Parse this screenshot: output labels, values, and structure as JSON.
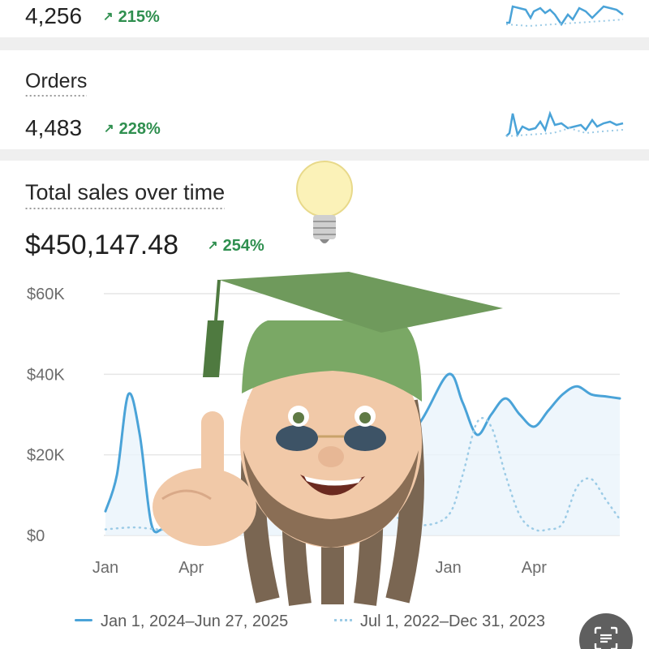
{
  "metrics": [
    {
      "title": "",
      "value": "4,256",
      "change": "215%"
    },
    {
      "title": "Orders",
      "value": "4,483",
      "change": "228%"
    }
  ],
  "sales": {
    "title": "Total sales over time",
    "total": "$450,147.48",
    "change": "254%"
  },
  "colors": {
    "accent": "#4aa3d8",
    "comparison": "#9ccbe6",
    "positive": "#2f8f4f",
    "gridline": "#e6e6e6"
  },
  "icons": {
    "change_arrow": "arrow-up-right-icon",
    "fab": "scan-text-icon",
    "overlay": "graduate-memoji-with-lightbulb"
  },
  "chart_data": {
    "type": "line",
    "title": "Total sales over time",
    "xlabel": "",
    "ylabel": "",
    "ylim": [
      0,
      60000
    ],
    "y_ticks": [
      "$60K",
      "$40K",
      "$20K",
      "$0"
    ],
    "x_ticks": [
      "Jan",
      "Apr",
      "",
      "Jan",
      "Apr"
    ],
    "grid": true,
    "legend_position": "bottom",
    "series": [
      {
        "name": "Jan 1, 2024–Jun 27, 2025",
        "style": "solid",
        "x": [
          0,
          0.4,
          0.8,
          1.2,
          1.6,
          2,
          2.5,
          3,
          3.5,
          4,
          4.5,
          5,
          6,
          7,
          8,
          9,
          10,
          11,
          12,
          12.5,
          13,
          13.5,
          14,
          14.5,
          15,
          15.5,
          16,
          16.5,
          17,
          17.5,
          18
        ],
        "values": [
          6000,
          15000,
          35000,
          25000,
          3000,
          1500,
          2000,
          3000,
          4000,
          3500,
          3000,
          4000,
          15000,
          25000,
          20000,
          30000,
          22000,
          28000,
          40000,
          33000,
          25000,
          30000,
          34000,
          30000,
          27000,
          31000,
          35000,
          37000,
          35000,
          34500,
          34000
        ]
      },
      {
        "name": "Jul 1, 2022–Dec 31, 2023",
        "style": "dotted",
        "x": [
          0,
          1,
          2,
          3,
          4,
          5,
          6,
          7,
          8,
          9,
          10,
          11,
          12,
          12.5,
          13,
          13.5,
          14,
          14.5,
          15,
          15.5,
          16,
          16.5,
          17,
          17.5,
          18
        ],
        "values": [
          1500,
          2000,
          1500,
          2500,
          3000,
          4000,
          6000,
          8000,
          10000,
          7000,
          5000,
          2500,
          5000,
          15000,
          28000,
          27000,
          15000,
          5000,
          1500,
          1500,
          3000,
          12000,
          14000,
          9000,
          4000
        ]
      }
    ]
  }
}
